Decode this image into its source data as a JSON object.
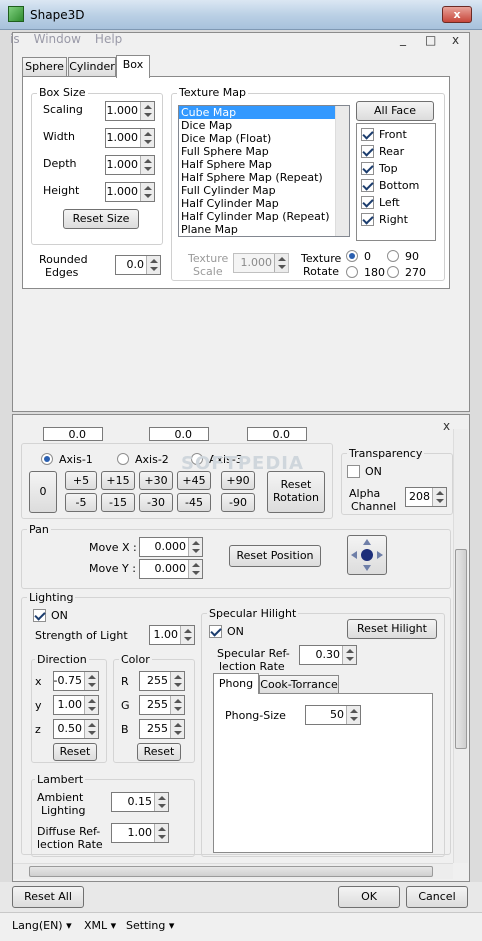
{
  "window": {
    "title": "Shape3D",
    "close": "x"
  },
  "menubar": {
    "items": [
      "is",
      "Window",
      "Help"
    ],
    "min": "_",
    "max": "□",
    "close": "x"
  },
  "tabs": [
    {
      "label": "Sphere"
    },
    {
      "label": "Cylinder"
    },
    {
      "label": "Box"
    }
  ],
  "box_size": {
    "title": "Box Size",
    "scaling_label": "Scaling",
    "scaling": "1.000",
    "width_label": "Width",
    "width": "1.000",
    "depth_label": "Depth",
    "depth": "1.000",
    "height_label": "Height",
    "height": "1.000",
    "reset": "Reset Size"
  },
  "rounded": {
    "label1": "Rounded",
    "label2": "Edges",
    "value": "0.0"
  },
  "texture": {
    "title": "Texture Map",
    "items": [
      "Cube Map",
      "Dice Map",
      "Dice Map (Float)",
      "Full Sphere Map",
      "Half Sphere Map",
      "Half Sphere Map (Repeat)",
      "Full Cylinder Map",
      "Half Cylinder Map",
      "Half Cylinder Map (Repeat)",
      "Plane Map"
    ],
    "scale_label1": "Texture",
    "scale_label2": "Scale",
    "scale": "1.000",
    "rotate_label1": "Texture",
    "rotate_label2": "Rotate",
    "rot": [
      "0",
      "90",
      "180",
      "270"
    ]
  },
  "faces": {
    "all": "All Face",
    "items": [
      "Front",
      "Rear",
      "Top",
      "Bottom",
      "Left",
      "Right"
    ]
  },
  "rotation": {
    "axes": [
      "Axis-1",
      "Axis-2",
      "Axis-3"
    ],
    "zero": "0",
    "plus": [
      "+5",
      "+15",
      "+30",
      "+45",
      "+90"
    ],
    "minus": [
      "-5",
      "-15",
      "-30",
      "-45",
      "-90"
    ],
    "reset1": "Reset",
    "reset2": "Rotation",
    "top_values": [
      "0.0",
      "0.0",
      "0.0"
    ]
  },
  "transparency": {
    "title": "Transparency",
    "on": "ON",
    "alpha1": "Alpha",
    "alpha2": "Channel",
    "alpha": "208"
  },
  "pan": {
    "title": "Pan",
    "move_x_label": "Move X :",
    "move_x": "0.000",
    "move_y_label": "Move Y :",
    "move_y": "0.000",
    "reset": "Reset Position"
  },
  "lighting": {
    "title": "Lighting",
    "on": "ON",
    "strength_label": "Strength of Light",
    "strength": "1.00",
    "direction": {
      "title": "Direction",
      "x_label": "x",
      "x": "-0.75",
      "y_label": "y",
      "y": "1.00",
      "z_label": "z",
      "z": "0.50",
      "reset": "Reset"
    },
    "color": {
      "title": "Color",
      "r_label": "R",
      "r": "255",
      "g_label": "G",
      "g": "255",
      "b_label": "B",
      "b": "255",
      "reset": "Reset"
    },
    "lambert": {
      "title": "Lambert",
      "ambient1": "Ambient",
      "ambient2": "Lighting",
      "ambient": "0.15",
      "diffuse1": "Diffuse Ref-",
      "diffuse2": "lection Rate",
      "diffuse": "1.00"
    }
  },
  "specular": {
    "title": "Specular Hilight",
    "on": "ON",
    "reset": "Reset Hilight",
    "rate1": "Specular Ref-",
    "rate2": "lection Rate",
    "rate": "0.30",
    "tabs": [
      "Phong",
      "Cook-Torrance"
    ],
    "phong_label": "Phong-Size",
    "phong": "50"
  },
  "buttons": {
    "reset_all": "Reset All",
    "ok": "OK",
    "cancel": "Cancel"
  },
  "statusbar": {
    "items": [
      "Lang(EN)",
      "XML",
      "Setting"
    ]
  },
  "watermark": "SOFTPEDIA"
}
